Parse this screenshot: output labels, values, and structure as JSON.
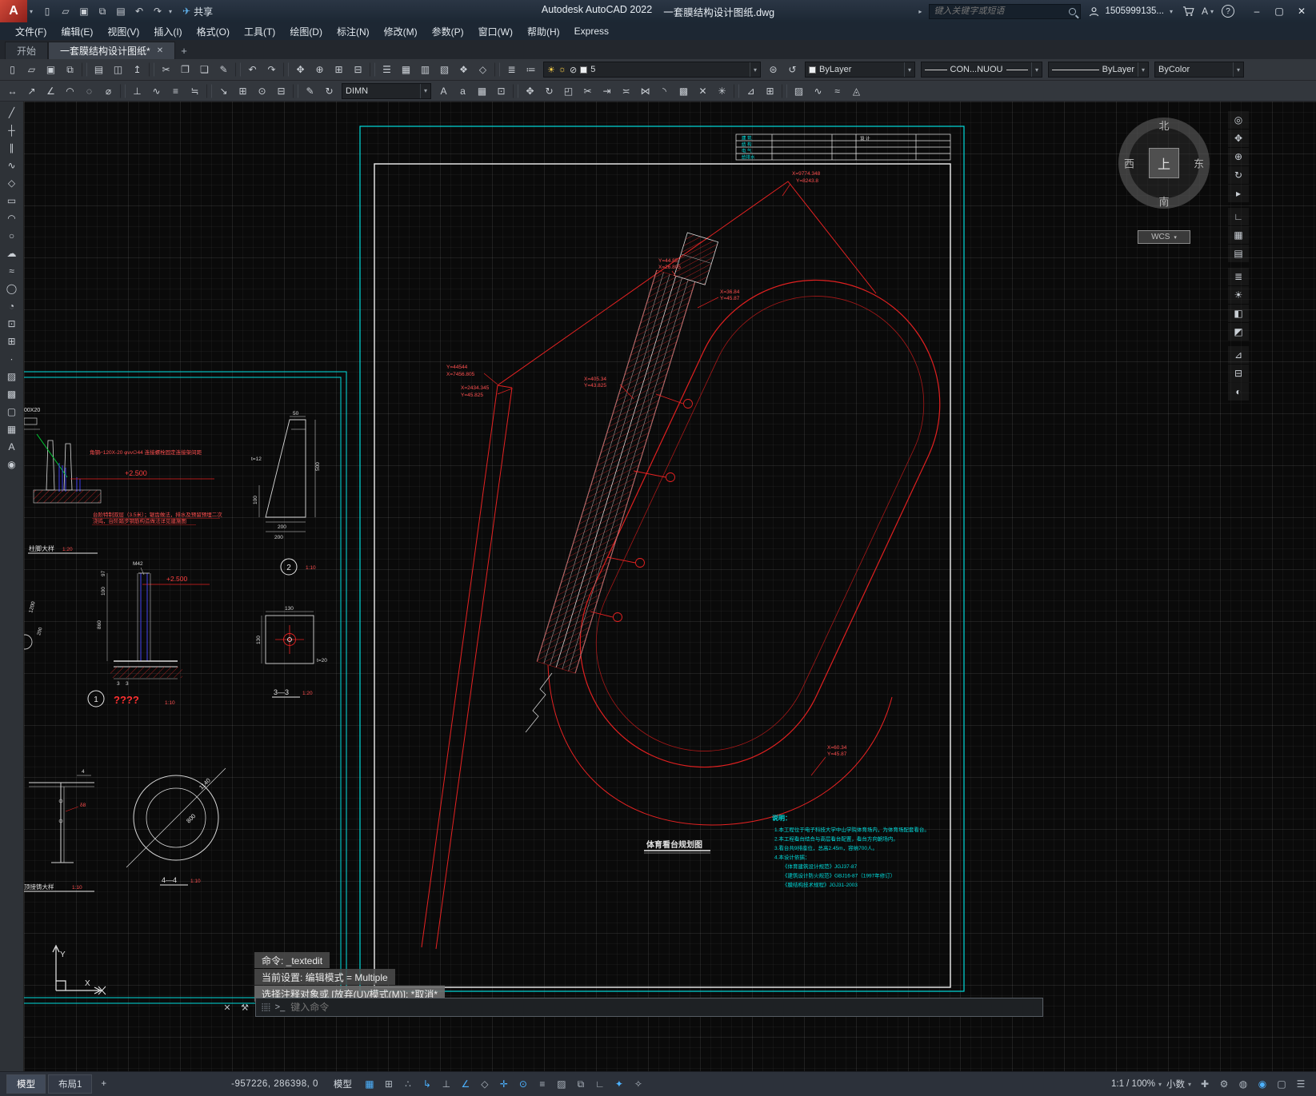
{
  "glyphs": {
    "caret": "▾",
    "right_caret": "▸",
    "close": "✕",
    "plus": "+",
    "min": "–",
    "max": "▢",
    "help": "?",
    "grip": "⣿⣿",
    "prompt": ">_",
    "wrench": "⚒",
    "share_plane": "✈"
  },
  "titlebar": {
    "app_title": "Autodesk AutoCAD 2022",
    "doc_title": "一套膜结构设计图纸.dwg",
    "share_label": "共享",
    "search_placeholder": "键入关键字或短语",
    "account": "1505999135...",
    "account_badge": "A",
    "qat": [
      {
        "name": "qat-new-icon",
        "glyph": "▯"
      },
      {
        "name": "qat-open-icon",
        "glyph": "▱"
      },
      {
        "name": "qat-save-icon",
        "glyph": "▣"
      },
      {
        "name": "qat-saveas-icon",
        "glyph": "⧉"
      },
      {
        "name": "qat-plot-icon",
        "glyph": "▤"
      },
      {
        "name": "qat-undo-icon",
        "glyph": "↶"
      },
      {
        "name": "qat-redo-icon",
        "glyph": "↷"
      }
    ]
  },
  "menubar": [
    {
      "name": "menu-file",
      "label": "文件(F)"
    },
    {
      "name": "menu-edit",
      "label": "编辑(E)"
    },
    {
      "name": "menu-view",
      "label": "视图(V)"
    },
    {
      "name": "menu-insert",
      "label": "插入(I)"
    },
    {
      "name": "menu-format",
      "label": "格式(O)"
    },
    {
      "name": "menu-tools",
      "label": "工具(T)"
    },
    {
      "name": "menu-draw",
      "label": "绘图(D)"
    },
    {
      "name": "menu-dimension",
      "label": "标注(N)"
    },
    {
      "name": "menu-modify",
      "label": "修改(M)"
    },
    {
      "name": "menu-parametric",
      "label": "参数(P)"
    },
    {
      "name": "menu-window",
      "label": "窗口(W)"
    },
    {
      "name": "menu-help",
      "label": "帮助(H)"
    },
    {
      "name": "menu-express",
      "label": "Express"
    }
  ],
  "tabbar": {
    "start_tab": "开始",
    "doc_tab": "一套膜结构设计图纸*"
  },
  "ribbon": {
    "row1_icons": [
      {
        "name": "qnew-icon",
        "glyph": "▯"
      },
      {
        "name": "open-icon",
        "glyph": "▱"
      },
      {
        "name": "save-icon",
        "glyph": "▣"
      },
      {
        "name": "saveas-icon",
        "glyph": "⧉"
      },
      {
        "name": "separator",
        "glyph": ""
      },
      {
        "name": "plot-icon",
        "glyph": "▤"
      },
      {
        "name": "plot-preview-icon",
        "glyph": "◫"
      },
      {
        "name": "publish-icon",
        "glyph": "↥"
      },
      {
        "name": "separator",
        "glyph": ""
      },
      {
        "name": "cut-icon",
        "glyph": "✂"
      },
      {
        "name": "copy-icon",
        "glyph": "❐"
      },
      {
        "name": "paste-icon",
        "glyph": "❏"
      },
      {
        "name": "match-properties-icon",
        "glyph": "✎"
      },
      {
        "name": "separator",
        "glyph": ""
      },
      {
        "name": "undo-icon",
        "glyph": "↶"
      },
      {
        "name": "redo-icon",
        "glyph": "↷"
      },
      {
        "name": "separator",
        "glyph": ""
      },
      {
        "name": "pan-icon",
        "glyph": "✥"
      },
      {
        "name": "zoom-realtime-icon",
        "glyph": "⊕"
      },
      {
        "name": "zoom-window-icon",
        "glyph": "⊞"
      },
      {
        "name": "zoom-previous-icon",
        "glyph": "⊟"
      },
      {
        "name": "separator",
        "glyph": ""
      },
      {
        "name": "properties-icon",
        "glyph": "☰"
      },
      {
        "name": "designcenter-icon",
        "glyph": "▦"
      },
      {
        "name": "toolpalettes-icon",
        "glyph": "▥"
      },
      {
        "name": "sheetset-icon",
        "glyph": "▧"
      },
      {
        "name": "markup-icon",
        "glyph": "❖"
      },
      {
        "name": "blockeditor-icon",
        "glyph": "◇"
      },
      {
        "name": "separator",
        "glyph": ""
      },
      {
        "name": "layer-properties-icon",
        "glyph": "≣"
      },
      {
        "name": "layer-states-icon",
        "glyph": "≔"
      }
    ],
    "layer_combo": {
      "g1": "☀",
      "g2": "☼",
      "g3": "⊘",
      "value": "5"
    },
    "row1_icons_b": [
      {
        "name": "layer-match-icon",
        "glyph": "⊜"
      },
      {
        "name": "layer-previous-icon",
        "glyph": "↺"
      }
    ],
    "color_combo": "ByLayer",
    "linetype_combo": "CON...NUOU",
    "lineweight_combo": "ByLayer",
    "plotstyle_combo": "ByColor",
    "row2_icons_left": [
      {
        "name": "dim-linear-icon",
        "glyph": "↔"
      },
      {
        "name": "dim-aligned-icon",
        "glyph": "↗"
      },
      {
        "name": "dim-angular-icon",
        "glyph": "∠"
      },
      {
        "name": "dim-arc-icon",
        "glyph": "◠"
      },
      {
        "name": "dim-radius-icon",
        "glyph": "◌"
      },
      {
        "name": "dim-diameter-icon",
        "glyph": "⌀"
      },
      {
        "name": "separator",
        "glyph": ""
      },
      {
        "name": "dim-ordinate-icon",
        "glyph": "⊥"
      },
      {
        "name": "dim-jogged-icon",
        "glyph": "∿"
      },
      {
        "name": "dim-baseline-icon",
        "glyph": "≡"
      },
      {
        "name": "dim-continue-icon",
        "glyph": "≒"
      },
      {
        "name": "separator",
        "glyph": ""
      },
      {
        "name": "qleader-icon",
        "glyph": "↘"
      },
      {
        "name": "dim-tolerance-icon",
        "glyph": "⊞"
      },
      {
        "name": "dim-center-icon",
        "glyph": "⊙"
      },
      {
        "name": "dim-break-icon",
        "glyph": "⊟"
      },
      {
        "name": "separator",
        "glyph": ""
      },
      {
        "name": "dim-edit-icon",
        "glyph": "✎"
      },
      {
        "name": "dim-update-icon",
        "glyph": "↻"
      }
    ],
    "dim_style_combo": "DIMN",
    "row2_icons_right": [
      {
        "name": "mtext-icon",
        "glyph": "A"
      },
      {
        "name": "single-text-icon",
        "glyph": "a"
      },
      {
        "name": "table-icon",
        "glyph": "▦"
      },
      {
        "name": "field-icon",
        "glyph": "⊡"
      },
      {
        "name": "separator",
        "glyph": ""
      },
      {
        "name": "move-icon",
        "glyph": "✥"
      },
      {
        "name": "rotate-icon",
        "glyph": "↻"
      },
      {
        "name": "scale-icon",
        "glyph": "◰"
      },
      {
        "name": "trim-icon",
        "glyph": "✂"
      },
      {
        "name": "extend-icon",
        "glyph": "⇥"
      },
      {
        "name": "offset-icon",
        "glyph": "≍"
      },
      {
        "name": "mirror-icon",
        "glyph": "⋈"
      },
      {
        "name": "fillet-icon",
        "glyph": "◝"
      },
      {
        "name": "array-icon",
        "glyph": "▩"
      },
      {
        "name": "erase-icon",
        "glyph": "✕"
      },
      {
        "name": "explode-icon",
        "glyph": "✳"
      },
      {
        "name": "separator",
        "glyph": ""
      },
      {
        "name": "measure-icon",
        "glyph": "⊿"
      },
      {
        "name": "quickcalc-icon",
        "glyph": "⊞"
      },
      {
        "name": "separator",
        "glyph": ""
      },
      {
        "name": "hatch-edit-icon",
        "glyph": "▨"
      },
      {
        "name": "polyline-edit-icon",
        "glyph": "∿"
      },
      {
        "name": "spline-edit-icon",
        "glyph": "≈"
      },
      {
        "name": "attribute-edit-icon",
        "glyph": "◬"
      }
    ]
  },
  "left_toolbar": [
    {
      "name": "line-tool-icon",
      "glyph": "╱"
    },
    {
      "name": "xline-tool-icon",
      "glyph": "┼"
    },
    {
      "name": "mline-tool-icon",
      "glyph": "∥"
    },
    {
      "name": "polyline-tool-icon",
      "glyph": "∿"
    },
    {
      "name": "polygon-tool-icon",
      "glyph": "◇"
    },
    {
      "name": "rectangle-tool-icon",
      "glyph": "▭"
    },
    {
      "name": "arc-tool-icon",
      "glyph": "◠"
    },
    {
      "name": "circle-tool-icon",
      "glyph": "○"
    },
    {
      "name": "revcloud-tool-icon",
      "glyph": "☁"
    },
    {
      "name": "spline-tool-icon",
      "glyph": "≈"
    },
    {
      "name": "ellipse-tool-icon",
      "glyph": "◯"
    },
    {
      "name": "ellipse-arc-tool-icon",
      "glyph": "◔"
    },
    {
      "name": "insert-block-tool-icon",
      "glyph": "⊡"
    },
    {
      "name": "make-block-tool-icon",
      "glyph": "⊞"
    },
    {
      "name": "point-tool-icon",
      "glyph": "∙"
    },
    {
      "name": "hatch-tool-icon",
      "glyph": "▨"
    },
    {
      "name": "gradient-tool-icon",
      "glyph": "▩"
    },
    {
      "name": "region-tool-icon",
      "glyph": "▢"
    },
    {
      "name": "table-tool-icon",
      "glyph": "▦"
    },
    {
      "name": "text-tool-icon",
      "glyph": "A"
    },
    {
      "name": "point-style-tool-icon",
      "glyph": "◉"
    }
  ],
  "nav_toolbar": [
    {
      "name": "nav-wheel-icon",
      "glyph": "◎"
    },
    {
      "name": "nav-pan-icon",
      "glyph": "✥"
    },
    {
      "name": "nav-zoom-icon",
      "glyph": "⊕"
    },
    {
      "name": "nav-orbit-icon",
      "glyph": "↻"
    },
    {
      "name": "nav-showmotion-icon",
      "glyph": "▸"
    },
    {
      "name": "separator",
      "glyph": ""
    },
    {
      "name": "nav-ucs-icon",
      "glyph": "∟"
    },
    {
      "name": "nav-views-icon",
      "glyph": "▦"
    },
    {
      "name": "nav-named-views-icon",
      "glyph": "▤"
    },
    {
      "name": "separator",
      "glyph": ""
    },
    {
      "name": "nav-layer-walk-icon",
      "glyph": "≣"
    },
    {
      "name": "nav-layer-off-icon",
      "glyph": "☀"
    },
    {
      "name": "nav-layer-isolate-icon",
      "glyph": "◧"
    },
    {
      "name": "nav-layer-lock-icon",
      "glyph": "◩"
    },
    {
      "name": "separator",
      "glyph": ""
    },
    {
      "name": "nav-measure-icon",
      "glyph": "⊿"
    },
    {
      "name": "nav-section-icon",
      "glyph": "⊟"
    },
    {
      "name": "nav-smooth-icon",
      "glyph": "◐"
    }
  ],
  "viewcube": {
    "north": "北",
    "south": "南",
    "east": "东",
    "west": "西",
    "center": "上",
    "wcs": "WCS"
  },
  "command": {
    "history": [
      "命令: _textedit",
      "当前设置: 编辑模式 = Multiple",
      "选择注释对象或 [放弃(U)/模式(M)]: *取消*"
    ],
    "placeholder": "键入命令"
  },
  "statusbar": {
    "model_tab": "模型",
    "layout_tab": "布局1",
    "coords": "-957226, 286398, 0",
    "space_label": "模型",
    "toggles": [
      {
        "name": "grid-toggle",
        "glyph": "▦",
        "active": true
      },
      {
        "name": "snap-toggle",
        "glyph": "⊞",
        "active": false
      },
      {
        "name": "infer-constraints-toggle",
        "glyph": "∴",
        "active": false
      },
      {
        "name": "dynamic-input-toggle",
        "glyph": "↳",
        "active": true
      },
      {
        "name": "ortho-toggle",
        "glyph": "⊥",
        "active": false
      },
      {
        "name": "polar-toggle",
        "glyph": "∠",
        "active": true
      },
      {
        "name": "isodraft-toggle",
        "glyph": "◇",
        "active": false
      },
      {
        "name": "otrack-toggle",
        "glyph": "✛",
        "active": true
      },
      {
        "name": "osnap-toggle",
        "glyph": "⊙",
        "active": true
      },
      {
        "name": "lineweight-toggle",
        "glyph": "≡",
        "active": false
      },
      {
        "name": "transparency-toggle",
        "glyph": "▨",
        "active": false
      },
      {
        "name": "selection-cycling-toggle",
        "glyph": "⧉",
        "active": false
      },
      {
        "name": "dynamic-ucs-toggle",
        "glyph": "∟",
        "active": false
      },
      {
        "name": "annotation-visibility-toggle",
        "glyph": "✦",
        "active": true
      },
      {
        "name": "autoscale-toggle",
        "glyph": "✧",
        "active": false
      }
    ],
    "scale": "1:1 / 100%",
    "units": "小数",
    "right_icons": [
      {
        "name": "annotation-scale-icon",
        "glyph": "✚",
        "active": false
      },
      {
        "name": "workspace-gear-icon",
        "glyph": "⚙",
        "active": false
      },
      {
        "name": "isolate-objects-icon",
        "glyph": "◍",
        "active": false
      },
      {
        "name": "graphics-performance-icon",
        "glyph": "◉",
        "active": true
      },
      {
        "name": "clean-screen-icon",
        "glyph": "▢",
        "active": false
      },
      {
        "name": "customization-icon",
        "glyph": "☰",
        "active": false
      }
    ]
  },
  "drawing": {
    "title_block": {
      "rows": [
        "建 筑",
        "结 构",
        "电 气",
        "给排水"
      ],
      "stamp": "设 计"
    },
    "coords": {
      "p1x": "X=9774.348",
      "p1y": "Y=8243.8",
      "p2y": "Y=44.85",
      "p2x": "X=26.805",
      "p3x": "X=36.84",
      "p3y": "Y=45.87",
      "p4y": "Y=44544",
      "p4x": "X=7456.805",
      "p5x": "X=2434.345",
      "p5y": "Y=45.825",
      "p6x": "X=60.34",
      "p6y": "Y=45.87",
      "p7x": "X=405.34",
      "p7y": "Y=43.825"
    },
    "plan_title": "体育看台规划图",
    "notes_title": "说明：",
    "notes": [
      "1.本工程位于电子科技大学中山学院体育场内，为体育场配套看台。",
      "2.本工程看台结合与高层看台配置，看台方向朝场内。",
      "3.看台共9排座位，总高2.45m，容纳700人。",
      "4.本设计依据：",
      "《体育建筑设计规范》JGJ37-87",
      "《建筑设计防火规范》GBJ16-87（1997年修订）",
      "《膜结构技术规程》JGJ31-2003"
    ],
    "details": {
      "d1_label": "柱脚大样",
      "d1_scale": "1:20",
      "d1_level": "+2.500",
      "d1_note_top": "角钢⌐120X-20 φνν∅44 连接螺栓固定连接架间距",
      "d1_note1": "台阶特制双层（3.5米）；锯齿做法，排水及预留预埋二次",
      "d1_note2": "浇捣，台阶踏步钢筋构造做法详见建施图",
      "d2_dim_top": "50",
      "d2_dim_right": "500",
      "d2_t": "t=12",
      "d2_dim_l": "100",
      "d2_dim_b1": "200",
      "d2_dim_b2": "200",
      "d3_bolt": "M42",
      "d3_level": "+2.500",
      "d3_dim1": "97",
      "d3_dim2": "100",
      "d3_dim3": "860",
      "d3_dim4": "3",
      "d3_dim5": "3",
      "d3_bubble": "1",
      "d3_missing": "????",
      "d3_scale": "1:10",
      "d4_bubble": "2",
      "d4_scale": "1:10",
      "d4_dim_top": "130",
      "d4_dim_left": "130",
      "d4_t": "t=20",
      "d4_label": "3—3",
      "d4_label_scale": "1:20",
      "d5_label": "顶接铸大样",
      "d5_scale": "1:10",
      "d5_dim": "4",
      "d5_thk": "δ8",
      "d6_dim_outer": "1140",
      "d6_dim_inner": "800",
      "d6_label": "4—4",
      "d6_scale": "1:10",
      "scrap_1": "00X20",
      "scrap_2": "1200",
      "scrap_3": "200"
    },
    "ucs": {
      "x": "X",
      "y": "Y"
    }
  }
}
